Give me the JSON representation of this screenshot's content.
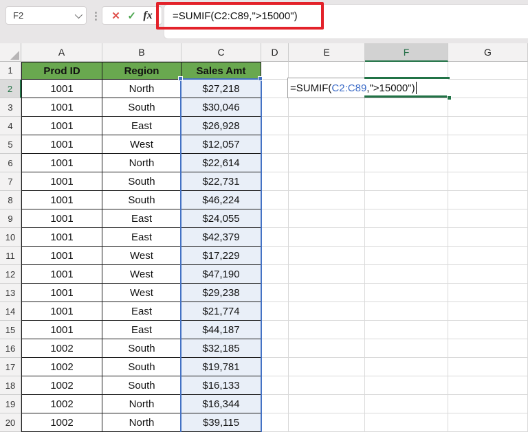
{
  "toolbar": {
    "name_box_value": "F2",
    "menu_dots": "⋮",
    "cancel_label": "✕",
    "enter_label": "✓",
    "fx_label": "fx",
    "formula": "=SUMIF(C2:C89,\">15000\")"
  },
  "cell_editor": {
    "prefix": "=SUMIF(",
    "reference": "C2:C89",
    "suffix": ",\">15000\")"
  },
  "grid": {
    "columns": [
      "A",
      "B",
      "C",
      "D",
      "E",
      "F",
      "G"
    ],
    "selected_column": "F",
    "selected_row": "2",
    "active_cell": "F2",
    "rows": [
      [
        "1",
        "Prod ID",
        "Region",
        "Sales Amt"
      ],
      [
        "2",
        "1001",
        "North",
        "$27,218"
      ],
      [
        "3",
        "1001",
        "South",
        "$30,046"
      ],
      [
        "4",
        "1001",
        "East",
        "$26,928"
      ],
      [
        "5",
        "1001",
        "West",
        "$12,057"
      ],
      [
        "6",
        "1001",
        "North",
        "$22,614"
      ],
      [
        "7",
        "1001",
        "South",
        "$22,731"
      ],
      [
        "8",
        "1001",
        "South",
        "$46,224"
      ],
      [
        "9",
        "1001",
        "East",
        "$24,055"
      ],
      [
        "10",
        "1001",
        "East",
        "$42,379"
      ],
      [
        "11",
        "1001",
        "West",
        "$17,229"
      ],
      [
        "12",
        "1001",
        "West",
        "$47,190"
      ],
      [
        "13",
        "1001",
        "West",
        "$29,238"
      ],
      [
        "14",
        "1001",
        "East",
        "$21,774"
      ],
      [
        "15",
        "1001",
        "East",
        "$44,187"
      ],
      [
        "16",
        "1002",
        "South",
        "$32,185"
      ],
      [
        "17",
        "1002",
        "South",
        "$19,781"
      ],
      [
        "18",
        "1002",
        "South",
        "$16,133"
      ],
      [
        "19",
        "1002",
        "North",
        "$16,344"
      ],
      [
        "20",
        "1002",
        "North",
        "$39,115"
      ]
    ]
  },
  "colors": {
    "table_header_fill": "#69a84f",
    "accent_green": "#217346",
    "range_border_blue": "#4472c4",
    "range_fill_blue": "#e9eff8",
    "annotation_red": "#e3222a"
  }
}
